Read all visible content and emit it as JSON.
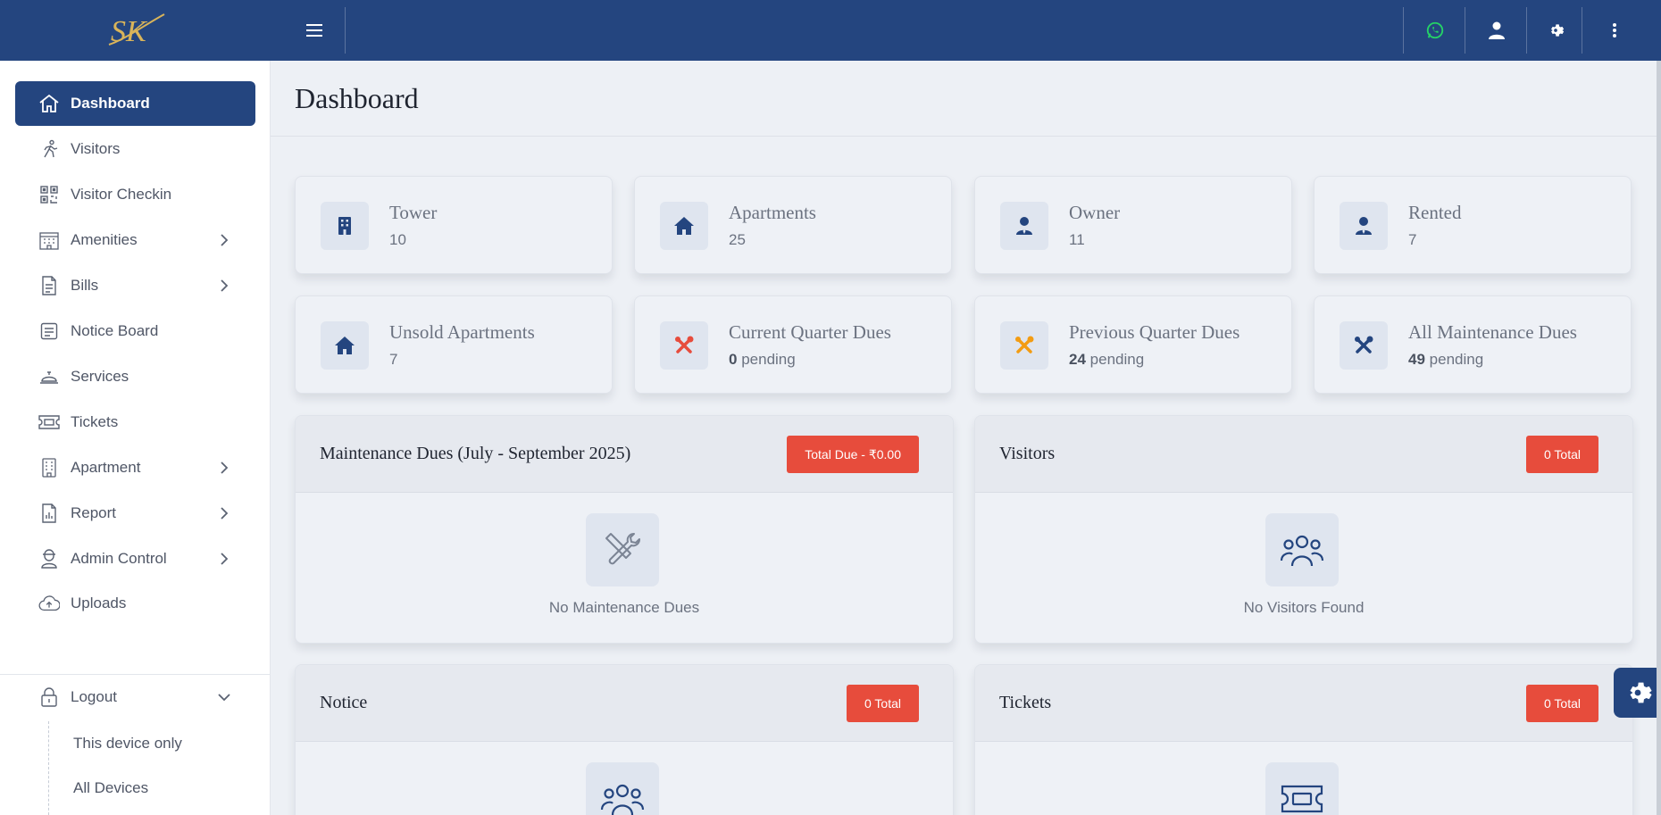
{
  "header": {
    "logo_text": "SK",
    "colors": {
      "topbar": "#24457f",
      "whatsapp": "#25d366"
    }
  },
  "sidebar": {
    "items": [
      {
        "label": "Dashboard",
        "icon": "home-icon"
      },
      {
        "label": "Visitors",
        "icon": "walking-person-icon"
      },
      {
        "label": "Visitor Checkin",
        "icon": "qr-code-icon"
      },
      {
        "label": "Amenities",
        "icon": "building-icon"
      },
      {
        "label": "Bills",
        "icon": "document-icon"
      },
      {
        "label": "Notice Board",
        "icon": "notice-icon"
      },
      {
        "label": "Services",
        "icon": "service-bell-icon"
      },
      {
        "label": "Tickets",
        "icon": "ticket-icon"
      },
      {
        "label": "Apartment",
        "icon": "apartment-icon"
      },
      {
        "label": "Report",
        "icon": "report-icon"
      },
      {
        "label": "Admin Control",
        "icon": "admin-icon"
      },
      {
        "label": "Uploads",
        "icon": "cloud-upload-icon"
      }
    ],
    "logout": {
      "label": "Logout",
      "sub_items": [
        "This device only",
        "All Devices"
      ]
    }
  },
  "main": {
    "title": "Dashboard",
    "stats": [
      {
        "label": "Tower",
        "value": "10"
      },
      {
        "label": "Apartments",
        "value": "25"
      },
      {
        "label": "Owner",
        "value": "11"
      },
      {
        "label": "Rented",
        "value": "7"
      },
      {
        "label": "Unsold Apartments",
        "value": "7"
      },
      {
        "label": "Current Quarter Dues",
        "count": "0",
        "suffix": "pending"
      },
      {
        "label": "Previous Quarter Dues",
        "count": "24",
        "suffix": "pending"
      },
      {
        "label": "All Maintenance Dues",
        "count": "49",
        "suffix": "pending"
      }
    ],
    "panels": {
      "maintenance": {
        "title": "Maintenance Dues (July - September 2025)",
        "badge": "Total Due - ₹0.00",
        "empty": "No Maintenance Dues"
      },
      "visitors": {
        "title": "Visitors",
        "badge": "0 Total",
        "empty": "No Visitors Found"
      },
      "notice": {
        "title": "Notice",
        "badge": "0 Total"
      },
      "tickets": {
        "title": "Tickets",
        "badge": "0 Total"
      }
    },
    "colors": {
      "accent": "#24457f",
      "badge": "#e74c3c",
      "dues_current": "#e74c3c",
      "dues_previous": "#f39c12"
    }
  }
}
